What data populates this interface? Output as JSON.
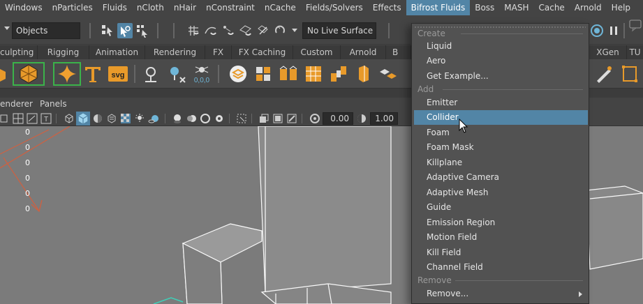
{
  "menubar": {
    "items": [
      "Windows",
      "nParticles",
      "Fluids",
      "nCloth",
      "nHair",
      "nConstraint",
      "nCache",
      "Fields/Solvers",
      "Effects",
      "Bifrost Fluids",
      "Boss",
      "MASH",
      "Cache",
      "Arnold",
      "Help"
    ],
    "active_index": 9
  },
  "statusline": {
    "selection_mode": "Objects",
    "live_surface": "No Live Surface"
  },
  "shelf": {
    "tabs": [
      "culpting",
      "Rigging",
      "Animation",
      "Rendering",
      "FX",
      "FX Caching",
      "Custom",
      "Arnold",
      "B",
      "XGen",
      "TU"
    ]
  },
  "panel": {
    "menus": [
      "enderer",
      "Panels"
    ],
    "field_a": "0.00",
    "field_b": "1.00"
  },
  "viewport": {
    "hud_values": [
      "0",
      "0",
      "0",
      "0",
      "0",
      "0"
    ]
  },
  "dropdown": {
    "sections": [
      {
        "title": "Create",
        "items": [
          "Liquid",
          "Aero",
          "Get Example..."
        ]
      },
      {
        "title": "Add",
        "items": [
          "Emitter",
          "Collider",
          "Foam",
          "Foam Mask",
          "Killplane",
          "Adaptive Camera",
          "Adaptive Mesh",
          "Guide",
          "Emission Region",
          "Motion Field",
          "Kill Field",
          "Channel Field"
        ]
      },
      {
        "title": "Remove",
        "items": [
          "Remove..."
        ]
      }
    ],
    "highlighted": "Collider"
  },
  "colors": {
    "highlight": "#5285a6",
    "ui_bg": "#444444",
    "viewport_bg": "#7b7b7b",
    "menu_bg": "#525252"
  }
}
